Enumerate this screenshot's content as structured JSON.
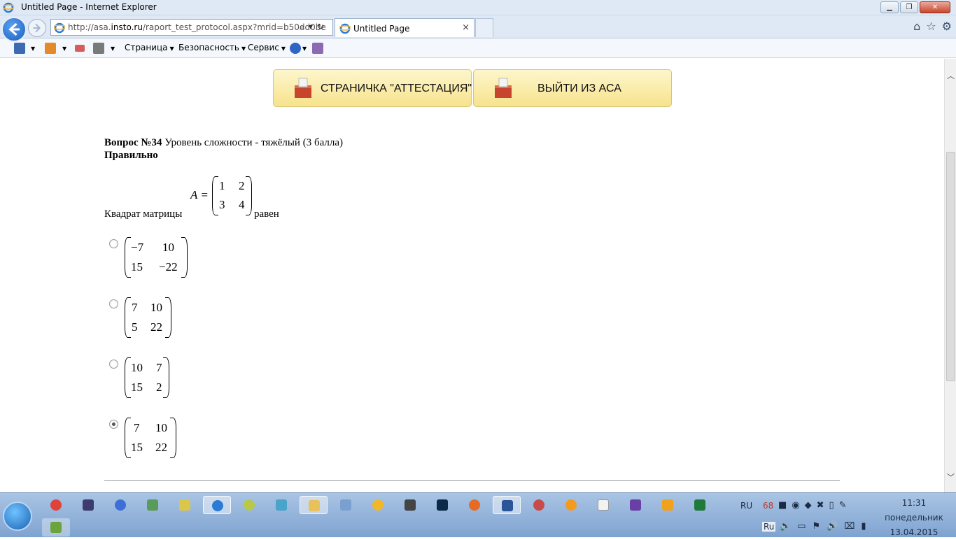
{
  "window": {
    "title": "Untitled Page - Internet Explorer"
  },
  "address": {
    "url_prefix": "http://asa.",
    "url_domain": "insto.ru",
    "url_path": "/raport_test_protocol.aspx?mrid=b50dd0be"
  },
  "tab": {
    "label": "Untitled Page",
    "close": "×"
  },
  "commandbar": {
    "page": "Страница",
    "safety": "Безопасность",
    "service": "Сервис"
  },
  "buttons": {
    "attest": "СТРАНИЧКА \"АТТЕСТАЦИЯ\"",
    "exit": "ВЫЙТИ ИЗ АСА"
  },
  "question": {
    "number_label": "Вопрос №34",
    "difficulty": "Уровень сложности - тяжёлый (3 балла)",
    "status": "Правильно",
    "text_before": "Квадрат матрицы",
    "text_after": "равен",
    "matrix_name": "A =",
    "matrix": [
      [
        "1",
        "2"
      ],
      [
        "3",
        "4"
      ]
    ]
  },
  "options": [
    {
      "cells": [
        [
          "−7",
          "10"
        ],
        [
          "15",
          "−22"
        ]
      ],
      "selected": false
    },
    {
      "cells": [
        [
          "7",
          "10"
        ],
        [
          "5",
          "22"
        ]
      ],
      "selected": false
    },
    {
      "cells": [
        [
          "10",
          "7"
        ],
        [
          "15",
          "2"
        ]
      ],
      "selected": false
    },
    {
      "cells": [
        [
          "7",
          "10"
        ],
        [
          "15",
          "22"
        ]
      ],
      "selected": true
    }
  ],
  "tray": {
    "lang": "RU",
    "lang2": "Ru",
    "battery_num": "68",
    "time": "11:31",
    "day": "понедельник",
    "date": "13.04.2015"
  }
}
